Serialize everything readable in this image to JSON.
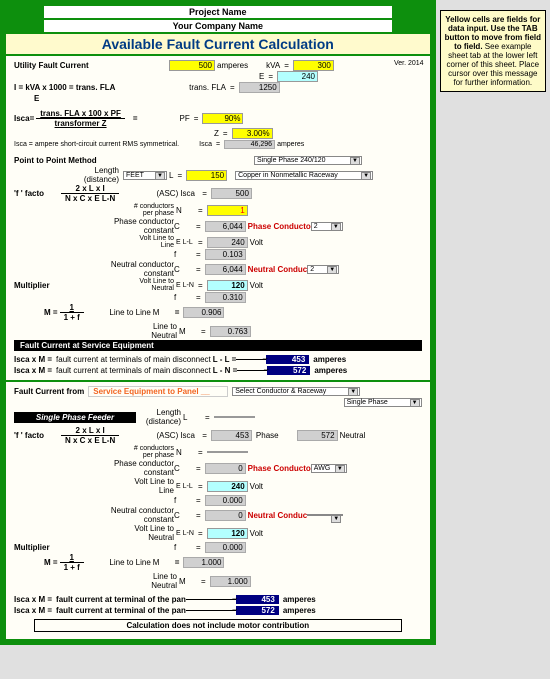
{
  "hdr": {
    "proj": "Project Name",
    "co": "Your Company Name",
    "title": "Available Fault Current Calculation",
    "ver": "Ver. 2014"
  },
  "side": {
    "bold": "Yellow cells are fields for data input. Use the TAB button to move from field to field.",
    "plain": "See example sheet tab at the lower left corner of this sheet. Place cursor over this message for further information."
  },
  "s1": {
    "ufc_lbl": "Utility Fault Current",
    "ufc": "500",
    "ufc_u": "amperes",
    "kva_l": "kVA",
    "kva": "300",
    "e_l": "E",
    "e": "240",
    "tfla_l": "trans. FLA",
    "tfla": "1250",
    "form1": "I = kVA x 1000 = trans. FLA",
    "form1b": "E",
    "isca_l": "Isca",
    "isca_f_top": "trans. FLA x 100 x PF",
    "isca_f_bot": "transformer  Z",
    "pf_l": "PF",
    "pf": "90%",
    "z_l": "Z",
    "z": "3.00%",
    "isca_v": "46,296",
    "isca_u": "amperes",
    "isca_note": "Isca = ampere short-circuit current RMS symmetrical.",
    "isca_nl": "Isca",
    "ptp": "Point to Point Method",
    "dd1": "Single Phase 240/120",
    "ff": "'f ' facto",
    "ff_t": "2 x L x I",
    "ff_b": "N x C x E L-N",
    "len_l": "Length (distance)",
    "feet": "FEET",
    "L": "L",
    "L_v": "150",
    "dd2": "Copper in Nonmetallic Raceway",
    "asc_l": "(ASC)",
    "I": "Isca",
    "asc_v": "500",
    "cpp": "# conductors per phase",
    "N": "N",
    "cpp_v": "1",
    "pcc": "Phase conductor constant",
    "C": "C",
    "pcc_v": "6,044",
    "pc": "Phase Conducto",
    "pc_dd": "2",
    "vll": "Volt Line to Line",
    "ELL": "E L-L",
    "vll_v": "240",
    "volt": "Volt",
    "f": "f",
    "f1": "0.103",
    "ncc": "Neutral conductor constant",
    "ncc_v": "6,044",
    "nc": "Neutral Conduc",
    "nc_dd": "2",
    "vln": "Volt Line to Neutral",
    "ELN": "E L-N",
    "vln_v": "120",
    "f2": "0.310",
    "mult": "Multiplier",
    "M": "M =",
    "m_top": "1",
    "m_bot": "1 + f",
    "ll": "Line to Line",
    "ln": "Line to Neutral",
    "Meq": "M",
    "m1": "0.906",
    "m2": "0.763",
    "fcse": "Fault Current at Service Equipment",
    "r1_l": "Isca  x  M  =",
    "r1_t": "fault current at terminals of main disconnect",
    "r1_s": "L - L =",
    "r1_v": "453",
    "amp": "amperes",
    "r2_s": "L - N =",
    "r2_v": "572"
  },
  "s2": {
    "fc_from": "Fault Current from",
    "se_to": "Service Equipment to Panel __",
    "dd3": "Select Conductor & Raceway",
    "dd4": "Single Phase",
    "spf": "Single Phase Feeder",
    "len_l": "Length (distance)",
    "L": "L",
    "ff": "'f ' facto",
    "ff_t": "2 x L x I",
    "ff_b": "N x C x E L-N",
    "asc_l": "(ASC)",
    "I": "Isca",
    "asc_v": "453",
    "ph": "Phase",
    "neu_v": "572",
    "neu": "Neutral",
    "cpp": "# conductors per phase",
    "N": "N",
    "pcc": "Phase conductor constant",
    "C": "C",
    "pcc_v": "0",
    "pc": "Phase Conducto",
    "awg": "AWG",
    "vll": "Volt Line to Line",
    "ELL": "E L-L",
    "vll_v": "240",
    "volt": "Volt",
    "f": "f",
    "f1": "0.000",
    "ncc": "Neutral conductor constant",
    "ncc_v": "0",
    "nc": "Neutral Conduc",
    "vln": "Volt Line to Neutral",
    "ELN": "E L-N",
    "vln_v": "120",
    "f2": "0.000",
    "mult": "Multiplier",
    "M": "M =",
    "m_top": "1",
    "m_bot": "1 + f",
    "ll": "Line to Line",
    "ln": "Line to Neutral",
    "Meq": "M",
    "m1": "1.000",
    "m2": "1.000",
    "r_l": "Isca  x  M  =",
    "r_t": "fault current at terminal of the pan",
    "r1_v": "453",
    "amp": "amperes",
    "r2_v": "572",
    "note": "Calculation does not include motor contribution"
  }
}
